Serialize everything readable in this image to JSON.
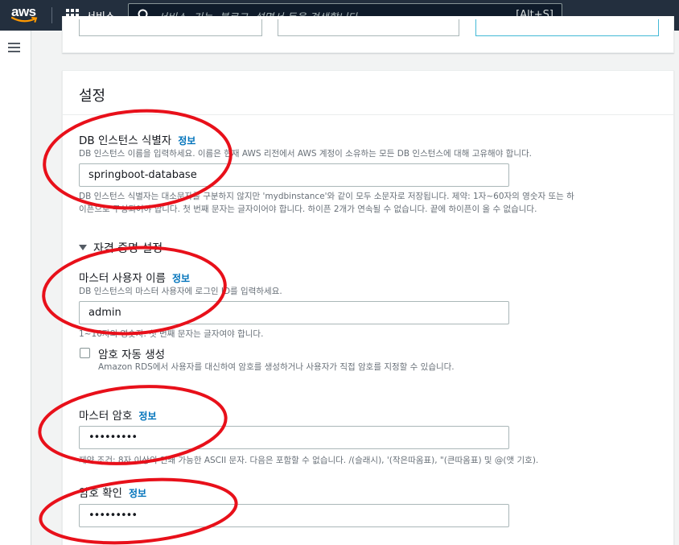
{
  "topbar": {
    "logo_text": "aws",
    "services_label": "서비스",
    "search_placeholder": "서비스, 기능, 블로그, 설명서 등을 검색합니다.",
    "search_shortcut": "[Alt+S]"
  },
  "panel": {
    "title": "설정",
    "db_identifier": {
      "label": "DB 인스턴스 식별자",
      "info": "정보",
      "description": "DB 인스턴스 이름을 입력하세요. 이름은 현재 AWS 리전에서 AWS 계정이 소유하는 모든 DB 인스턴스에 대해 고유해야 합니다.",
      "value": "springboot-database",
      "constraint_line1": "DB 인스턴스 식별자는 대소문자를 구분하지 않지만 'mydbinstance'와 같이 모두 소문자로 저장됩니다. 제약: 1자~60자의 영숫자 또는 하",
      "constraint_line2": "이픈으로 구성되어야 합니다. 첫 번째 문자는 글자이어야 합니다. 하이픈 2개가 연속될 수 없습니다. 끝에 하이픈이 올 수 없습니다."
    },
    "credentials_section": {
      "title": "자격 증명 설정"
    },
    "master_username": {
      "label": "마스터 사용자 이름",
      "info": "정보",
      "description": "DB 인스턴스의 마스터 사용자에 로그인 ID를 입력하세요.",
      "value": "admin",
      "constraint": "1~16자의 영숫자. 첫 번째 문자는 글자여야 합니다."
    },
    "auto_password": {
      "label": "암호 자동 생성",
      "description": "Amazon RDS에서 사용자를 대신하여 암호를 생성하거나 사용자가 직접 암호를 지정할 수 있습니다.",
      "checked": false
    },
    "master_password": {
      "label": "마스터 암호",
      "info": "정보",
      "value": "•••••••••",
      "constraint": "제약 조건: 8자 이상의 인쇄 가능한 ASCII 문자. 다음은 포함할 수 없습니다. /(슬래시), '(작은따옴표), \"(큰따옴표) 및 @(앳 기호)."
    },
    "confirm_password": {
      "label": "암호 확인",
      "info": "정보",
      "value": "•••••••••"
    }
  },
  "colors": {
    "nav_bg": "#232f3e",
    "info_link": "#0073bb",
    "annotation_red": "#e8101a",
    "aws_orange": "#ff9900"
  }
}
